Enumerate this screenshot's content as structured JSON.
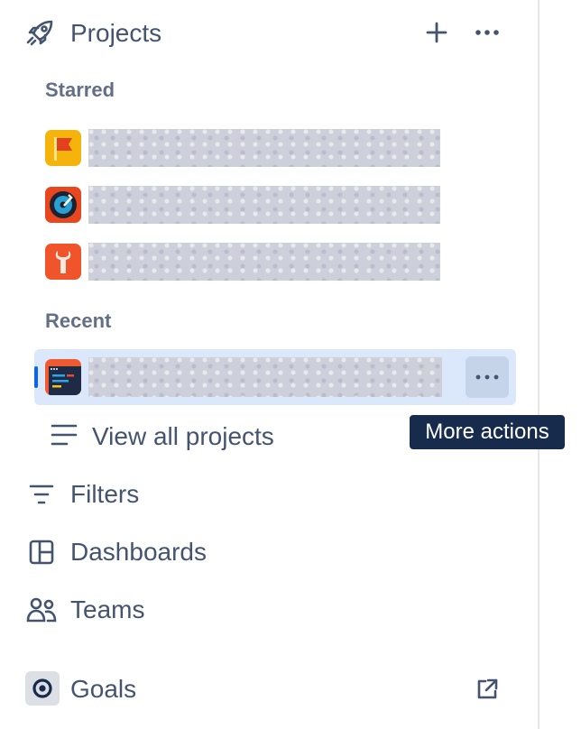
{
  "projects_header": {
    "title": "Projects",
    "icon": "rocket-icon",
    "add_icon": "plus-icon",
    "more_icon": "more-horizontal-icon"
  },
  "starred": {
    "label": "Starred",
    "items": [
      {
        "icon": "flag-project-icon",
        "name": ""
      },
      {
        "icon": "disc-project-icon",
        "name": ""
      },
      {
        "icon": "wrench-project-icon",
        "name": ""
      }
    ]
  },
  "recent": {
    "label": "Recent",
    "items": [
      {
        "icon": "code-project-icon",
        "name": "",
        "selected": true
      }
    ]
  },
  "view_all": {
    "label": "View all projects",
    "icon": "list-icon"
  },
  "tooltip": {
    "text": "More actions"
  },
  "nav": {
    "filters": {
      "label": "Filters",
      "icon": "filter-icon"
    },
    "dashboards": {
      "label": "Dashboards",
      "icon": "dashboard-icon"
    },
    "teams": {
      "label": "Teams",
      "icon": "people-icon"
    },
    "goals": {
      "label": "Goals",
      "icon": "goal-icon",
      "external_icon": "external-link-icon"
    }
  },
  "colors": {
    "text": "#44546f",
    "selected_bg": "#dbe8fc",
    "selected_indicator": "#0c66e4",
    "tooltip_bg": "#172b4d"
  }
}
